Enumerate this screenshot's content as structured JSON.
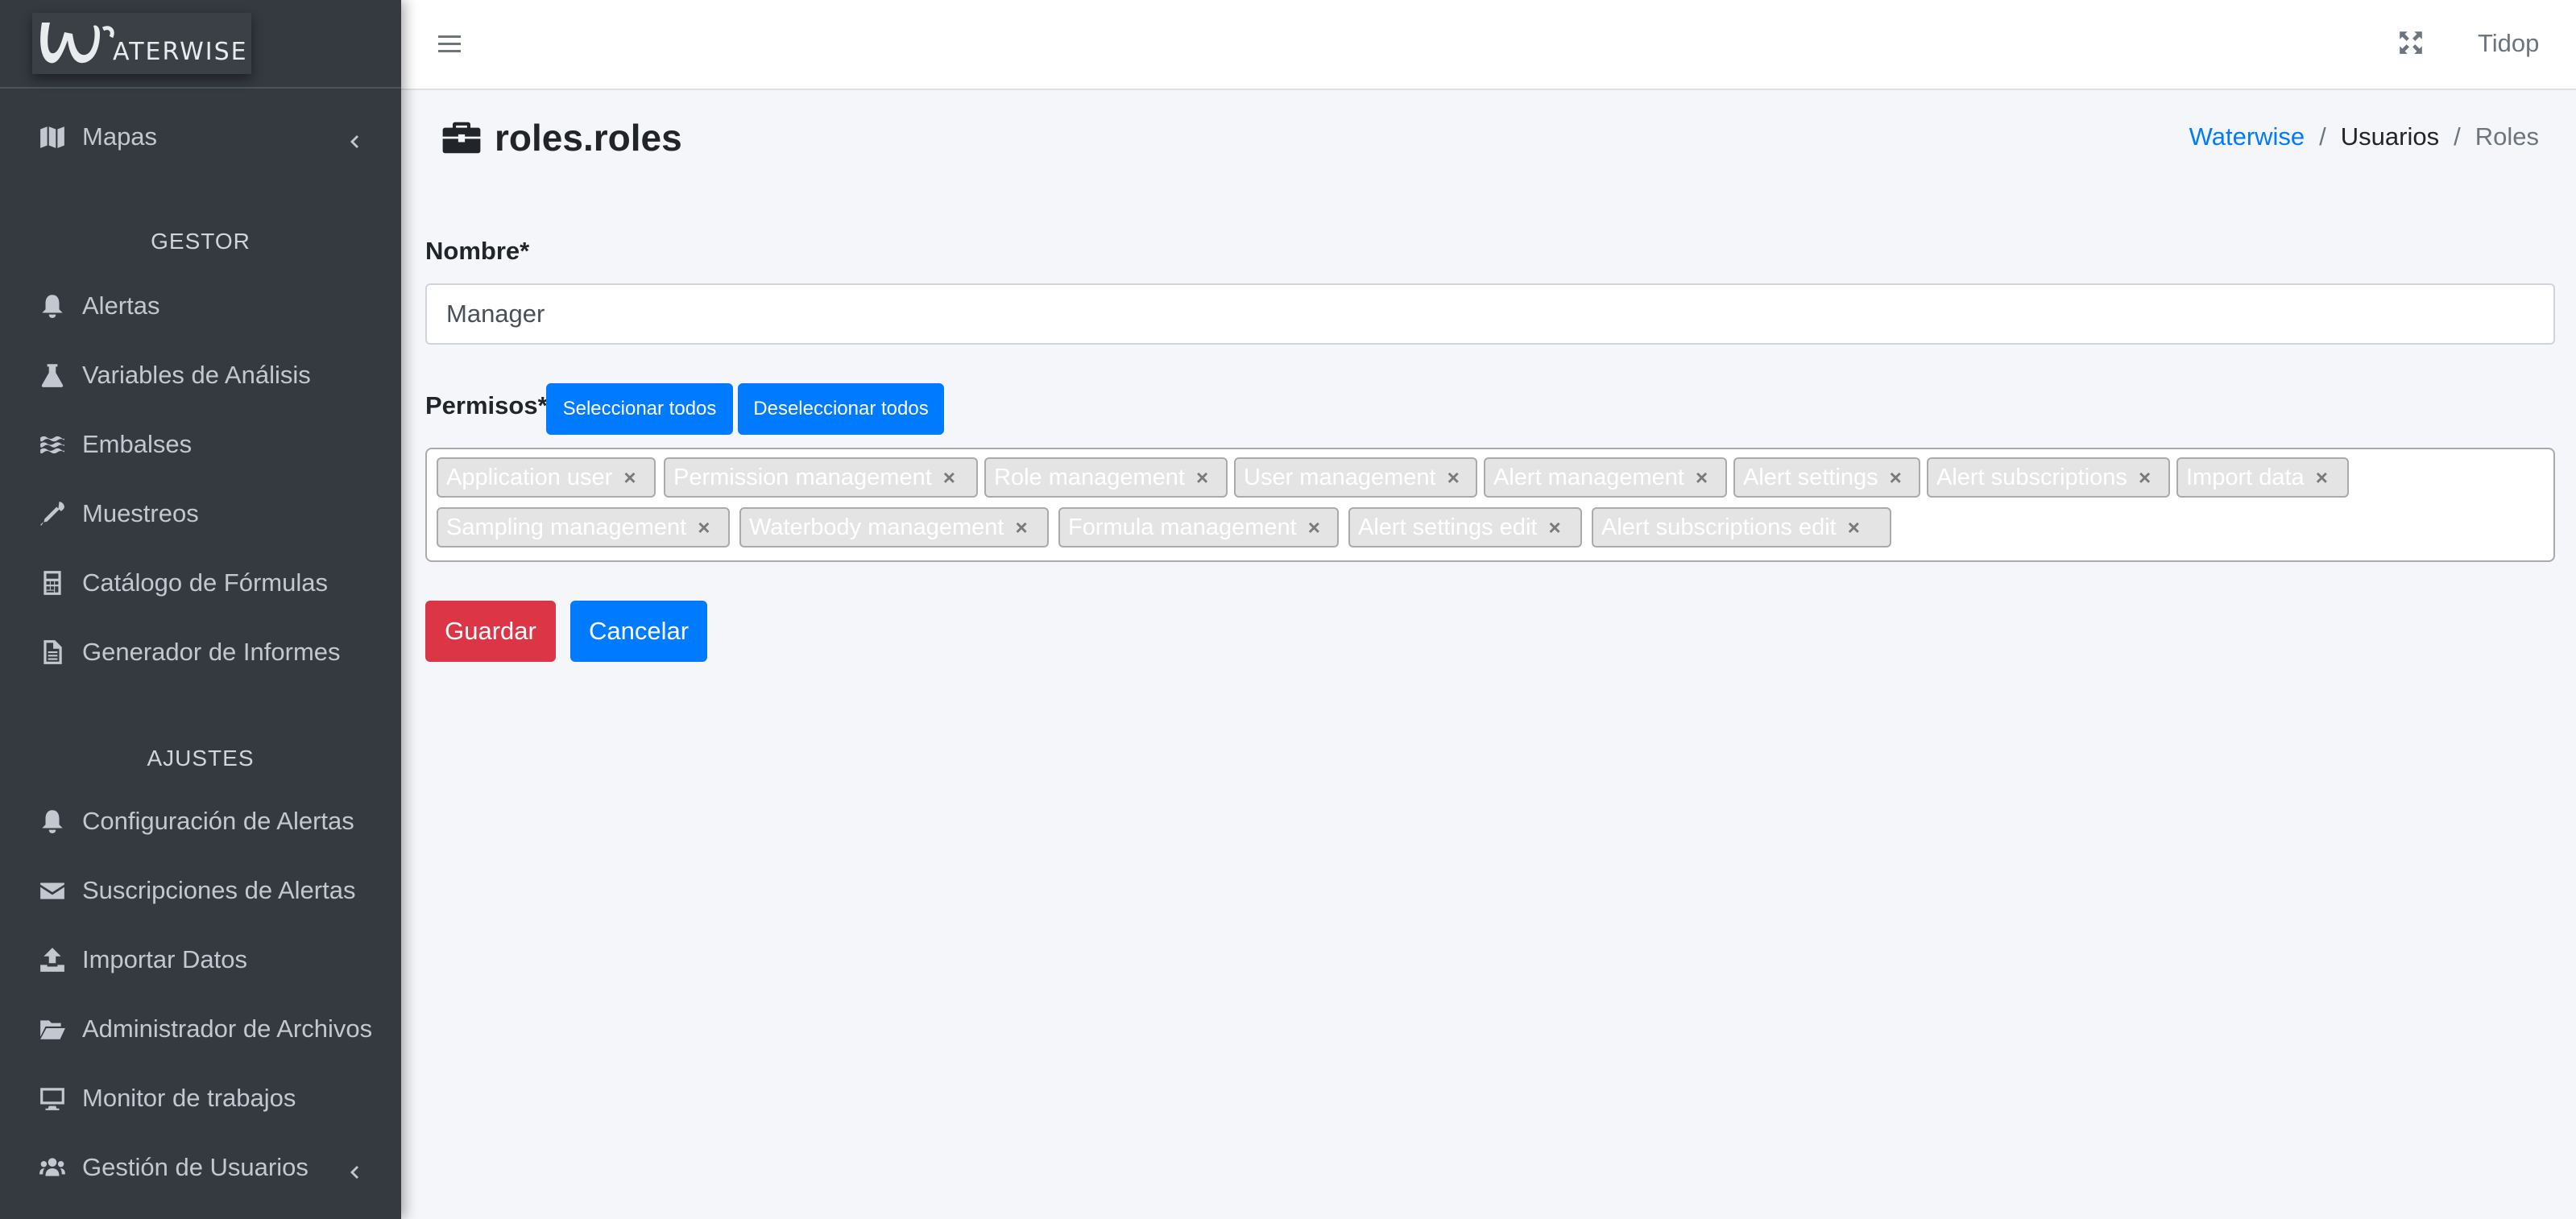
{
  "brand": {
    "text": "ATERWISE"
  },
  "sidebar": {
    "items": [
      {
        "label": "Mapas",
        "icon": "map-icon"
      },
      {
        "header": "GESTOR"
      },
      {
        "label": "Alertas",
        "icon": "bell-icon"
      },
      {
        "label": "Variables de Análisis",
        "icon": "flask-icon"
      },
      {
        "label": "Embalses",
        "icon": "water-icon"
      },
      {
        "label": "Muestreos",
        "icon": "eyedropper-icon"
      },
      {
        "label": "Catálogo de Fórmulas",
        "icon": "calculator-icon"
      },
      {
        "label": "Generador de Informes",
        "icon": "file-alt-icon"
      },
      {
        "header": "AJUSTES"
      },
      {
        "label": "Configuración de Alertas",
        "icon": "bell-icon"
      },
      {
        "label": "Suscripciones de Alertas",
        "icon": "envelope-icon"
      },
      {
        "label": "Importar Datos",
        "icon": "upload-icon"
      },
      {
        "label": "Administrador de Archivos",
        "icon": "folder-open-icon"
      },
      {
        "label": "Monitor de trabajos",
        "icon": "desktop-icon"
      },
      {
        "label": "Gestión de Usuarios",
        "icon": "users-icon"
      }
    ]
  },
  "topbar": {
    "user": "Tidop"
  },
  "page": {
    "title": "roles.roles",
    "breadcrumb": [
      "Waterwise",
      "Usuarios",
      "Roles"
    ]
  },
  "form": {
    "name_label": "Nombre*",
    "name_value": "Manager",
    "permissions_label": "Permisos*",
    "select_all": "Seleccionar todos",
    "deselect_all": "Deseleccionar todos",
    "permissions": [
      "Application user",
      "Permission management",
      "Role management",
      "User management",
      "Alert management",
      "Alert settings",
      "Alert subscriptions",
      "Import data",
      "Sampling management",
      "Waterbody management",
      "Formula management",
      "Alert settings edit",
      "Alert subscriptions edit"
    ],
    "tag_remove": "×",
    "save": "Guardar",
    "cancel": "Cancelar"
  },
  "colors": {
    "sidebar_bg": "#343a40",
    "primary": "#007bff",
    "danger": "#dc3545",
    "content_bg": "#f4f6f9"
  }
}
